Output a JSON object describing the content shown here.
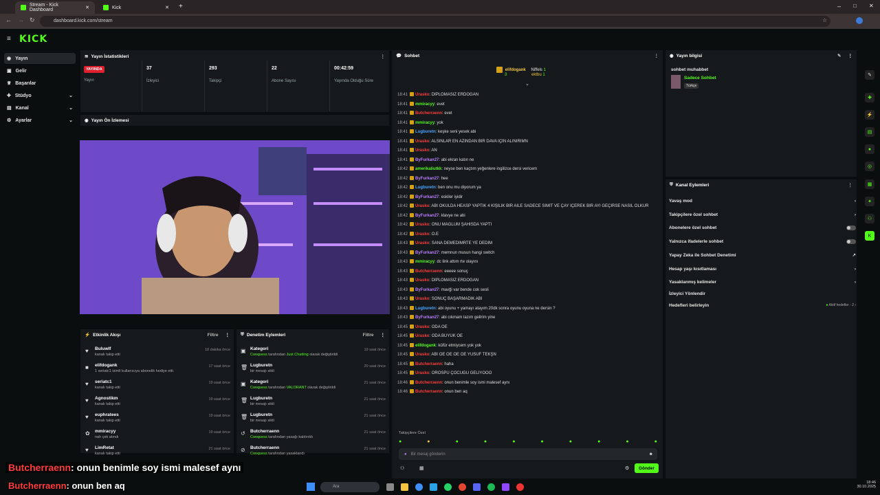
{
  "browser": {
    "tabs": [
      {
        "label": "Stream - Kick Dashboard"
      },
      {
        "label": "Kick"
      }
    ],
    "url": "dashboard.kick.com/stream"
  },
  "sidebar": {
    "items": [
      {
        "label": "Yayın",
        "icon": "broadcast-icon"
      },
      {
        "label": "Gelir",
        "icon": "money-icon"
      },
      {
        "label": "Başarılar",
        "icon": "trophy-icon"
      },
      {
        "label": "Stüdyo",
        "icon": "studio-icon"
      },
      {
        "label": "Kanal",
        "icon": "channel-icon"
      },
      {
        "label": "Ayarlar",
        "icon": "gear-icon"
      }
    ]
  },
  "stats": {
    "title": "Yayın İstatistikleri",
    "live_badge": "YAYINDA",
    "live_label": "Yayın",
    "items": [
      {
        "value": "37",
        "label": "İzleyici"
      },
      {
        "value": "293",
        "label": "Takipçi"
      },
      {
        "value": "22",
        "label": "Abone Sayısı"
      },
      {
        "value": "00:42:59",
        "label": "Yayında Olduğu Süre"
      }
    ]
  },
  "preview": {
    "title": "Yayın Ön İzlemesi"
  },
  "activity": {
    "title": "Etkinlik Akışı",
    "filter": "Filtre",
    "rows": [
      {
        "name": "Buluwlf",
        "desc": "kanalı takip etti",
        "time": "18 dakika önce"
      },
      {
        "name": "elifdogank",
        "desc": "1 seriatc1 isimli kullanıcıya abonelik hediye etti.",
        "time": "17 saat önce"
      },
      {
        "name": "seriatc1",
        "desc": "kanalı takip etti",
        "time": "19 saat önce"
      },
      {
        "name": "Agnostikm",
        "desc": "kanalı takip etti",
        "time": "19 saat önce"
      },
      {
        "name": "euphratees",
        "desc": "kanalı takip etti",
        "time": "19 saat önce"
      },
      {
        "name": "mmiracyy",
        "desc": "nah çek atındı",
        "time": "19 saat önce"
      },
      {
        "name": "LimRetat",
        "desc": "kanalı takip etti",
        "time": "21 saat önce"
      }
    ]
  },
  "moderation": {
    "title": "Denetim Eylemleri",
    "filter": "Filtre",
    "rows": [
      {
        "name": "Kategori",
        "desc_a": "Conquess",
        "desc_b": " tarafından ",
        "desc_c": "Just Chatting",
        "desc_d": " olarak değiştirildi",
        "time": "19 saat önce"
      },
      {
        "name": "Lugburetn",
        "desc_a": "",
        "desc_b": "bir mesajı sildi",
        "desc_c": "",
        "desc_d": "",
        "time": "20 saat önce"
      },
      {
        "name": "Kategori",
        "desc_a": "Conquess",
        "desc_b": " tarafından ",
        "desc_c": "VALORANT",
        "desc_d": " olarak değiştirildi",
        "time": "21 saat önce"
      },
      {
        "name": "Lugburetn",
        "desc_a": "",
        "desc_b": "bir mesajı sildi",
        "desc_c": "",
        "desc_d": "",
        "time": "21 saat önce"
      },
      {
        "name": "Lugburetn",
        "desc_a": "",
        "desc_b": "bir mesajı sildi",
        "desc_c": "",
        "desc_d": "",
        "time": "21 saat önce"
      },
      {
        "name": "Butcherraenn",
        "desc_a": "Conquess",
        "desc_b": " tarafından yasağı kaldırıldı",
        "desc_c": "",
        "desc_d": "",
        "time": "21 saat önce"
      },
      {
        "name": "Butcherraenn",
        "desc_a": "Conquess",
        "desc_b": " tarafından yasaklandı",
        "desc_c": "",
        "desc_d": "",
        "time": "21 saat önce"
      }
    ]
  },
  "chat": {
    "title": "Sohbet",
    "top": {
      "user1": "elifdogank",
      "count1": "3",
      "user2": "Niffels",
      "count2": "1",
      "user3": "ektbu",
      "count3": "1"
    },
    "lines": [
      {
        "time": "18:41",
        "user": "Urasko",
        "cls": "u-red",
        "msg": ": DİPLOMASIZ ERDOĞAN"
      },
      {
        "time": "18:41",
        "user": "mmiracyy",
        "cls": "u-green",
        "msg": ": evet"
      },
      {
        "time": "18:41",
        "user": "Butcherraenn",
        "cls": "u-red",
        "msg": ": evet"
      },
      {
        "time": "18:41",
        "user": "mmiracyy",
        "cls": "u-green",
        "msg": ": yok"
      },
      {
        "time": "18:41",
        "user": "Lugburetn",
        "cls": "u-blue",
        "msg": ": keşke seni yesek abi"
      },
      {
        "time": "18:41",
        "user": "Urasko",
        "cls": "u-red",
        "msg": ": ALSINLAR EN AZINDAN BİR DAVA İÇİN ALINIRIMN"
      },
      {
        "time": "18:41",
        "user": "Urasko",
        "cls": "u-red",
        "msg": ": AN"
      },
      {
        "time": "18:41",
        "user": "ByFurkan27",
        "cls": "u-purple",
        "msg": ": abi ekran katın ne"
      },
      {
        "time": "18:42",
        "user": "amerikaliutkk",
        "cls": "u-green",
        "msg": ": neyse ben kaçtım yeğenlere ingilizce dersi vericem"
      },
      {
        "time": "18:42",
        "user": "ByFurkan27",
        "cls": "u-purple",
        "msg": ": hee"
      },
      {
        "time": "18:42",
        "user": "Lugburetn",
        "cls": "u-blue",
        "msg": ": ben onu mu diyorum ya"
      },
      {
        "time": "18:42",
        "user": "ByFurkan27",
        "cls": "u-purple",
        "msg": ": eskiler iyidir"
      },
      {
        "time": "18:42",
        "user": "Urasko",
        "cls": "u-red",
        "msg": ": ABİ OKULDA HEASP YAPTIK 4 KİŞİLİK BİR AİLE SADECE SİMİT VE ÇAY İÇEREK BİR AYI GEÇİRSE NASIL OLKUR"
      },
      {
        "time": "18:42",
        "user": "ByFurkan27",
        "cls": "u-purple",
        "msg": ": klavye ne abi"
      },
      {
        "time": "18:42",
        "user": "Urasko",
        "cls": "u-red",
        "msg": ": ONU MAĞLUM ŞAHISDA YAPTI"
      },
      {
        "time": "18:42",
        "user": "Urasko",
        "cls": "u-red",
        "msg": ": O.E"
      },
      {
        "time": "18:43",
        "user": "Urasko",
        "cls": "u-red",
        "msg": ": SANA DEMEDİMRTE YE DEDİM"
      },
      {
        "time": "18:43",
        "user": "ByFurkan27",
        "cls": "u-purple",
        "msg": ": memnun musun hangi switch"
      },
      {
        "time": "18:43",
        "user": "mmiracyy",
        "cls": "u-green",
        "msg": ": dc link attım rte olayını"
      },
      {
        "time": "18:43",
        "user": "Butcherraenn",
        "cls": "u-red",
        "msg": ": eeeee sonuç"
      },
      {
        "time": "18:43",
        "user": "Urasko",
        "cls": "u-red",
        "msg": ": DİPLOMASIZ ERDOĞAN"
      },
      {
        "time": "18:43",
        "user": "ByFurkan27",
        "cls": "u-purple",
        "msg": ": mavği var bende cok sesli"
      },
      {
        "time": "18:43",
        "user": "Urasko",
        "cls": "u-red",
        "msg": ": SONUÇ BAŞARMADIK ABİ"
      },
      {
        "time": "18:43",
        "user": "Lugburetn",
        "cls": "u-blue",
        "msg": ": abi oyunu + yamayı atayım 20dk sonra oyunu oyuna ne dersin ?"
      },
      {
        "time": "18:43",
        "user": "ByFurkan27",
        "cls": "u-purple",
        "msg": ": abi cıkmam lazım gelirim yine"
      },
      {
        "time": "18:45",
        "user": "Urasko",
        "cls": "u-red",
        "msg": ": ODA OE"
      },
      {
        "time": "18:45",
        "user": "Urasko",
        "cls": "u-red",
        "msg": ": ODA BÜYÜK OE"
      },
      {
        "time": "18:45",
        "user": "elifdogank",
        "cls": "u-green",
        "msg": ": küfür etmiycem yok yok"
      },
      {
        "time": "18:45",
        "user": "Urasko",
        "cls": "u-red",
        "msg": ": ABİ OE OE OE OE YUSUF TEKŞN"
      },
      {
        "time": "18:45",
        "user": "Butcherraenn",
        "cls": "u-red",
        "msg": ": haha"
      },
      {
        "time": "18:45",
        "user": "Urasko",
        "cls": "u-red",
        "msg": ": OROSPU ÇOCUĞU GELİYOOO"
      },
      {
        "time": "18:46",
        "user": "Butcherraenn",
        "cls": "u-red",
        "msg": ": onun benimle soy ismi malesef aynı"
      },
      {
        "time": "18:46",
        "user": "Butcherraenn",
        "cls": "u-red",
        "msg": ": onun ben aq"
      }
    ],
    "followers_only": "Takipçilere Özel",
    "placeholder": "Bir mesaj gönderin",
    "send": "Gönder"
  },
  "info": {
    "title": "Yayın bilgisi",
    "stream_title": "sohbet muhabbet",
    "category": "Sadece Sohbet",
    "lang": "Türkçe"
  },
  "actions": {
    "title": "Kanal Eylemleri",
    "rows": [
      {
        "label": "Yavaş mod",
        "ctl": "arrow"
      },
      {
        "label": "Takipçilere özel sohbet",
        "ctl": "arrow"
      },
      {
        "label": "Abonelere özel sohbet",
        "ctl": "toggle"
      },
      {
        "label": "Yalnızca ifadelerle sohbet",
        "ctl": "toggle"
      },
      {
        "label": "Yapay Zeka ile Sohbet Denetimi",
        "ctl": "ext"
      },
      {
        "label": "Hesap yaşı kısıtlaması",
        "ctl": "arrow"
      },
      {
        "label": "Yasaklanmış kelimeler",
        "ctl": "arrow"
      },
      {
        "label": "İzleyici Yönlendir",
        "ctl": ""
      },
      {
        "label": "Hedefleri belirleyin",
        "ctl": "goal"
      }
    ],
    "goal_status": "Aktif hedefler - 2"
  },
  "overlay": {
    "line1_user": "Butcherraenn",
    "line1_msg": ": onun benimle soy ismi malesef aynı",
    "line2_user": "Butcherraenn",
    "line2_msg": ": onun ben aq"
  },
  "taskbar": {
    "search": "Ara",
    "time": "18:46",
    "date": "30.10.2025"
  },
  "colors": {
    "accent": "#53fc18",
    "live": "#e0202f",
    "panel": "#16191b"
  }
}
